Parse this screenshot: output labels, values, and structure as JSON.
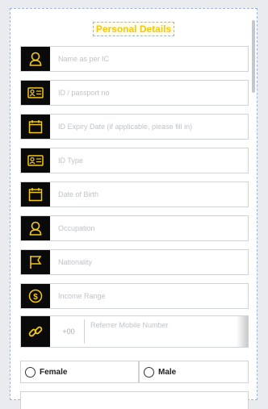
{
  "header": {
    "title": "Personal Details"
  },
  "fields": [
    {
      "icon": "person-icon",
      "placeholder": "Name as per IC"
    },
    {
      "icon": "id-card-icon",
      "placeholder": "ID / passport no"
    },
    {
      "icon": "calendar-icon",
      "placeholder": "ID Expiry Date (if applicable, please fill in)"
    },
    {
      "icon": "id-card-icon",
      "placeholder": "ID Type"
    },
    {
      "icon": "calendar-icon",
      "placeholder": "Date of Birth"
    },
    {
      "icon": "person-icon",
      "placeholder": "Occupation"
    },
    {
      "icon": "flag-icon",
      "placeholder": "Nationality"
    },
    {
      "icon": "dollar-icon",
      "placeholder": "Income Range"
    }
  ],
  "referrer": {
    "icon": "link-icon",
    "country_code": "+00",
    "placeholder": "Referrer Mobile Number"
  },
  "gender": {
    "female": "Female",
    "male": "Male"
  },
  "colors": {
    "accent": "#f3c712",
    "icon_bg": "#0a0a0a"
  }
}
